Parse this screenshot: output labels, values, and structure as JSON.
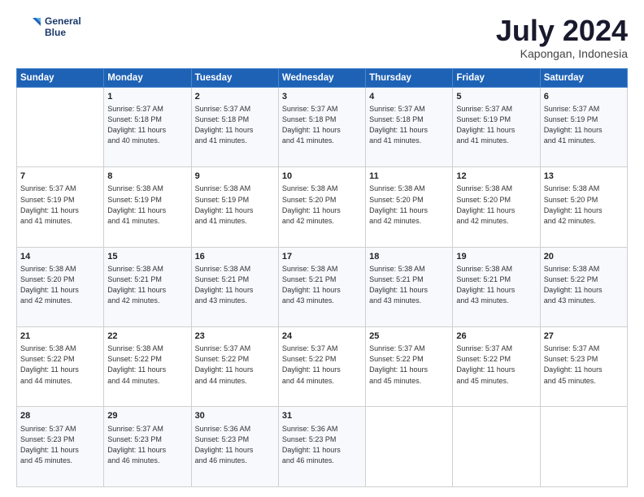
{
  "logo": {
    "line1": "General",
    "line2": "Blue"
  },
  "title": "July 2024",
  "location": "Kapongan, Indonesia",
  "days_header": [
    "Sunday",
    "Monday",
    "Tuesday",
    "Wednesday",
    "Thursday",
    "Friday",
    "Saturday"
  ],
  "weeks": [
    [
      {
        "num": "",
        "info": ""
      },
      {
        "num": "1",
        "info": "Sunrise: 5:37 AM\nSunset: 5:18 PM\nDaylight: 11 hours\nand 40 minutes."
      },
      {
        "num": "2",
        "info": "Sunrise: 5:37 AM\nSunset: 5:18 PM\nDaylight: 11 hours\nand 41 minutes."
      },
      {
        "num": "3",
        "info": "Sunrise: 5:37 AM\nSunset: 5:18 PM\nDaylight: 11 hours\nand 41 minutes."
      },
      {
        "num": "4",
        "info": "Sunrise: 5:37 AM\nSunset: 5:18 PM\nDaylight: 11 hours\nand 41 minutes."
      },
      {
        "num": "5",
        "info": "Sunrise: 5:37 AM\nSunset: 5:19 PM\nDaylight: 11 hours\nand 41 minutes."
      },
      {
        "num": "6",
        "info": "Sunrise: 5:37 AM\nSunset: 5:19 PM\nDaylight: 11 hours\nand 41 minutes."
      }
    ],
    [
      {
        "num": "7",
        "info": "Sunrise: 5:37 AM\nSunset: 5:19 PM\nDaylight: 11 hours\nand 41 minutes."
      },
      {
        "num": "8",
        "info": "Sunrise: 5:38 AM\nSunset: 5:19 PM\nDaylight: 11 hours\nand 41 minutes."
      },
      {
        "num": "9",
        "info": "Sunrise: 5:38 AM\nSunset: 5:19 PM\nDaylight: 11 hours\nand 41 minutes."
      },
      {
        "num": "10",
        "info": "Sunrise: 5:38 AM\nSunset: 5:20 PM\nDaylight: 11 hours\nand 42 minutes."
      },
      {
        "num": "11",
        "info": "Sunrise: 5:38 AM\nSunset: 5:20 PM\nDaylight: 11 hours\nand 42 minutes."
      },
      {
        "num": "12",
        "info": "Sunrise: 5:38 AM\nSunset: 5:20 PM\nDaylight: 11 hours\nand 42 minutes."
      },
      {
        "num": "13",
        "info": "Sunrise: 5:38 AM\nSunset: 5:20 PM\nDaylight: 11 hours\nand 42 minutes."
      }
    ],
    [
      {
        "num": "14",
        "info": "Sunrise: 5:38 AM\nSunset: 5:20 PM\nDaylight: 11 hours\nand 42 minutes."
      },
      {
        "num": "15",
        "info": "Sunrise: 5:38 AM\nSunset: 5:21 PM\nDaylight: 11 hours\nand 42 minutes."
      },
      {
        "num": "16",
        "info": "Sunrise: 5:38 AM\nSunset: 5:21 PM\nDaylight: 11 hours\nand 43 minutes."
      },
      {
        "num": "17",
        "info": "Sunrise: 5:38 AM\nSunset: 5:21 PM\nDaylight: 11 hours\nand 43 minutes."
      },
      {
        "num": "18",
        "info": "Sunrise: 5:38 AM\nSunset: 5:21 PM\nDaylight: 11 hours\nand 43 minutes."
      },
      {
        "num": "19",
        "info": "Sunrise: 5:38 AM\nSunset: 5:21 PM\nDaylight: 11 hours\nand 43 minutes."
      },
      {
        "num": "20",
        "info": "Sunrise: 5:38 AM\nSunset: 5:22 PM\nDaylight: 11 hours\nand 43 minutes."
      }
    ],
    [
      {
        "num": "21",
        "info": "Sunrise: 5:38 AM\nSunset: 5:22 PM\nDaylight: 11 hours\nand 44 minutes."
      },
      {
        "num": "22",
        "info": "Sunrise: 5:38 AM\nSunset: 5:22 PM\nDaylight: 11 hours\nand 44 minutes."
      },
      {
        "num": "23",
        "info": "Sunrise: 5:37 AM\nSunset: 5:22 PM\nDaylight: 11 hours\nand 44 minutes."
      },
      {
        "num": "24",
        "info": "Sunrise: 5:37 AM\nSunset: 5:22 PM\nDaylight: 11 hours\nand 44 minutes."
      },
      {
        "num": "25",
        "info": "Sunrise: 5:37 AM\nSunset: 5:22 PM\nDaylight: 11 hours\nand 45 minutes."
      },
      {
        "num": "26",
        "info": "Sunrise: 5:37 AM\nSunset: 5:22 PM\nDaylight: 11 hours\nand 45 minutes."
      },
      {
        "num": "27",
        "info": "Sunrise: 5:37 AM\nSunset: 5:23 PM\nDaylight: 11 hours\nand 45 minutes."
      }
    ],
    [
      {
        "num": "28",
        "info": "Sunrise: 5:37 AM\nSunset: 5:23 PM\nDaylight: 11 hours\nand 45 minutes."
      },
      {
        "num": "29",
        "info": "Sunrise: 5:37 AM\nSunset: 5:23 PM\nDaylight: 11 hours\nand 46 minutes."
      },
      {
        "num": "30",
        "info": "Sunrise: 5:36 AM\nSunset: 5:23 PM\nDaylight: 11 hours\nand 46 minutes."
      },
      {
        "num": "31",
        "info": "Sunrise: 5:36 AM\nSunset: 5:23 PM\nDaylight: 11 hours\nand 46 minutes."
      },
      {
        "num": "",
        "info": ""
      },
      {
        "num": "",
        "info": ""
      },
      {
        "num": "",
        "info": ""
      }
    ]
  ]
}
